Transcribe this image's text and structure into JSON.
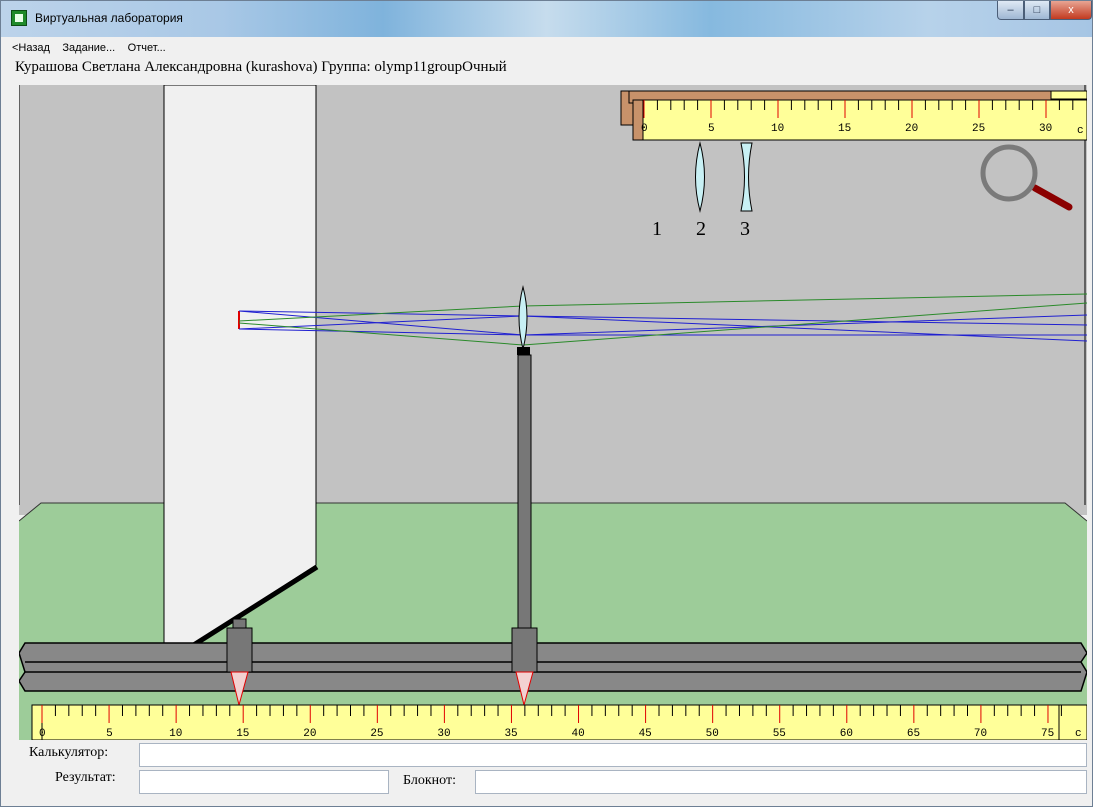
{
  "window": {
    "title": "Виртуальная лаборатория",
    "icon": "app-icon",
    "controls": {
      "minimize": "–",
      "maximize": "□",
      "close": "x"
    }
  },
  "menu": {
    "back": "<Назад",
    "task": "Задание...",
    "report": "Отчет..."
  },
  "user": {
    "line": "Курашова Светлана Александровна (kurashova)  Группа: olymp11groupОчный"
  },
  "lens_selector": {
    "labels": [
      "1",
      "2",
      "3"
    ]
  },
  "top_ruler": {
    "labels": [
      "0",
      "5",
      "10",
      "15",
      "20",
      "25",
      "30"
    ],
    "unit": "c"
  },
  "bench_ruler": {
    "labels": [
      "0",
      "5",
      "10",
      "15",
      "20",
      "25",
      "30",
      "35",
      "40",
      "45",
      "50",
      "55",
      "60",
      "65",
      "70",
      "75"
    ],
    "unit": "c"
  },
  "bench": {
    "screen_position": 14.8,
    "lens_position": 36.0
  },
  "bottom": {
    "calculator_label": "Калькулятор:",
    "calculator_value": "",
    "result_label": "Результат:",
    "result_value": "",
    "notepad_label": "Блокнот:",
    "notepad_value": ""
  },
  "colors": {
    "wall": "#c2c2c2",
    "floor": "#9dcc99",
    "ruler": "#ffff99",
    "ray_blue": "#2020d0",
    "ray_green": "#2a8a2a",
    "tick_red": "#e00000"
  }
}
